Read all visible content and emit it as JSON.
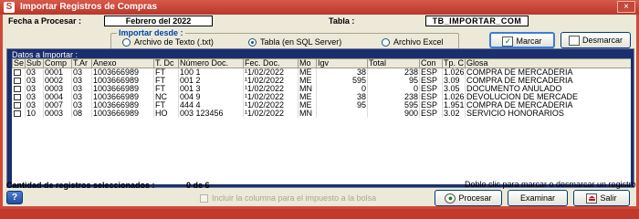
{
  "window": {
    "title": "Importar Registros de Compras",
    "close": "×",
    "app_icon": "S"
  },
  "header": {
    "fecha_label": "Fecha a Procesar :",
    "fecha_value": "Febrero del 2022",
    "tabla_label": "Tabla :",
    "tabla_value": "TB_IMPORTAR_COM"
  },
  "import_from": {
    "title": "Importar desde :",
    "options": [
      "Archivo de Texto (.txt)",
      "Tabla (en SQL Server)",
      "Archivo Excel"
    ],
    "selected": "Tabla (en SQL Server)"
  },
  "buttons": {
    "marcar": "Marcar",
    "desmarcar": "Desmarcar",
    "procesar": "Procesar",
    "examinar": "Examinar",
    "salir": "Salir",
    "help": "?"
  },
  "grid": {
    "title": "Datos a Importar :",
    "columns": [
      "Se",
      "Sub",
      "Comp",
      "T.Ar",
      "Anexo",
      "T. Dc",
      "Número Doc.",
      "Fec. Doc.",
      "Mo",
      "Igv",
      "Total",
      "Con",
      "Tp. C",
      "Glosa"
    ],
    "rows": [
      [
        "",
        "03",
        "0001",
        "03",
        "1003666989",
        "FT",
        "100 1",
        "¹1/02/2022",
        "ME",
        "38",
        "238",
        "ESP",
        "1.026",
        "COMPRA DE MERCADERIA"
      ],
      [
        "",
        "03",
        "0002",
        "03",
        "1003666989",
        "FT",
        "001 2",
        "¹1/02/2022",
        "ME",
        "595",
        "95",
        "ESP",
        "3.09",
        "COMPRA DE MERCADERIA"
      ],
      [
        "",
        "03",
        "0003",
        "03",
        "1003666989",
        "FT",
        "001 3",
        "¹1/02/2022",
        "MN",
        "0",
        "0",
        "ESP",
        "3.05",
        "DOCUMENTO ANULADO"
      ],
      [
        "",
        "03",
        "0004",
        "03",
        "1003666989",
        "NC",
        "004 9",
        "¹1/02/2022",
        "ME",
        "38",
        "238",
        "ESP",
        "1.026",
        "DEVOLUCION DE MERCADE"
      ],
      [
        "",
        "03",
        "0007",
        "03",
        "1003666989",
        "FT",
        "444 4",
        "¹1/02/2022",
        "ME",
        "95",
        "595",
        "ESP",
        "1.951",
        "COMPRA DE MERCADERIA"
      ],
      [
        "",
        "10",
        "0003",
        "08",
        "1003666989",
        "HO",
        "003 123456",
        "¹1/02/2022",
        "MN",
        "",
        "900",
        "ESP",
        "3.02",
        "SERVICIO HONORARIOS"
      ]
    ]
  },
  "status": {
    "count_label": "Cantidad de registros seleccionados :",
    "count_value": "0 de 6",
    "hint": "Doble clic para marcar o desmarcar un registro",
    "checkbox_label": "Incluir la columna para el impuesto a la bolsa"
  },
  "colors": {
    "title_bar": "#c0392b",
    "grid_header_bg": "#1b2e6e",
    "group_title": "#0045a6"
  },
  "icons": {
    "marcar": "checkmark-icon",
    "desmarcar": "uncheck-icon",
    "procesar": "process-icon",
    "salir": "exit-icon"
  }
}
